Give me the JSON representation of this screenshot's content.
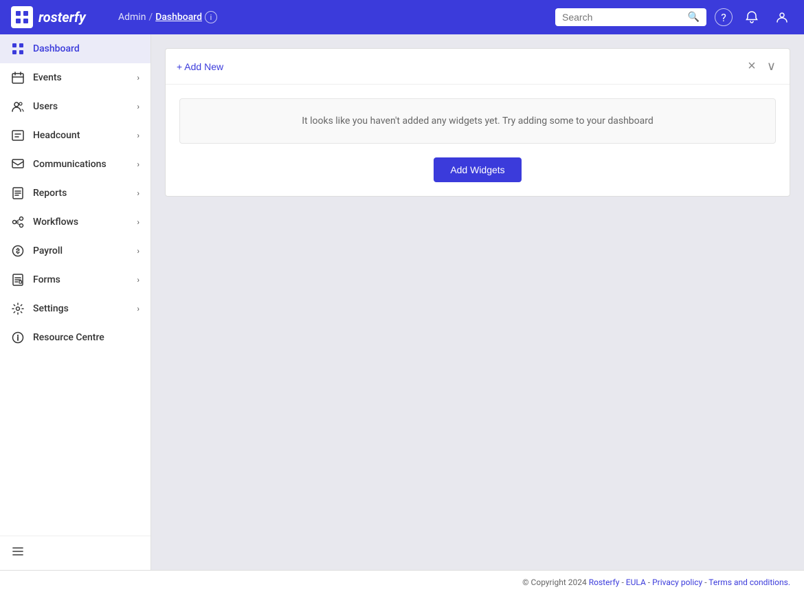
{
  "brand": {
    "name": "rosterfy"
  },
  "header": {
    "breadcrumb_admin": "Admin",
    "breadcrumb_separator": "/",
    "breadcrumb_current": "Dashboard",
    "search_placeholder": "Search",
    "help_icon": "?",
    "bell_icon": "🔔",
    "user_icon": "👤"
  },
  "sidebar": {
    "items": [
      {
        "id": "dashboard",
        "label": "Dashboard",
        "icon": "dashboard",
        "active": true,
        "hasChevron": false
      },
      {
        "id": "events",
        "label": "Events",
        "icon": "events",
        "active": false,
        "hasChevron": true
      },
      {
        "id": "users",
        "label": "Users",
        "icon": "users",
        "active": false,
        "hasChevron": true
      },
      {
        "id": "headcount",
        "label": "Headcount",
        "icon": "headcount",
        "active": false,
        "hasChevron": true
      },
      {
        "id": "communications",
        "label": "Communications",
        "icon": "communications",
        "active": false,
        "hasChevron": true
      },
      {
        "id": "reports",
        "label": "Reports",
        "icon": "reports",
        "active": false,
        "hasChevron": true
      },
      {
        "id": "workflows",
        "label": "Workflows",
        "icon": "workflows",
        "active": false,
        "hasChevron": true
      },
      {
        "id": "payroll",
        "label": "Payroll",
        "icon": "payroll",
        "active": false,
        "hasChevron": true
      },
      {
        "id": "forms",
        "label": "Forms",
        "icon": "forms",
        "active": false,
        "hasChevron": true
      },
      {
        "id": "settings",
        "label": "Settings",
        "icon": "settings",
        "active": false,
        "hasChevron": true
      },
      {
        "id": "resource-centre",
        "label": "Resource Centre",
        "icon": "resource",
        "active": false,
        "hasChevron": false
      }
    ]
  },
  "main": {
    "widget_panel": {
      "add_new_label": "+ Add New",
      "close_icon": "×",
      "collapse_icon": "∨",
      "empty_state_text": "It looks like you haven't added any widgets yet. Try adding some to your dashboard",
      "add_widgets_label": "Add Widgets"
    }
  },
  "footer": {
    "copyright": "© Copyright 2024",
    "brand_link": "Rosterfy",
    "separator1": "-",
    "eula_link": "EULA",
    "separator2": "-",
    "privacy_link": "Privacy policy",
    "separator3": "-",
    "terms_link": "Terms and conditions."
  }
}
